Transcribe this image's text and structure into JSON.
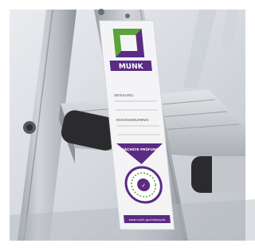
{
  "photo": {
    "subject": "aluminium-ladder-with-inspection-label",
    "colors": {
      "background": "#ffffff",
      "aluminium": "#c3c6ca",
      "aluminium_shadow": "#8e939a",
      "step_cap": "#2b2b2d",
      "label_white": "#f4f4f6",
      "brand_green": "#5aa43a",
      "brand_purple": "#5b2c83"
    }
  },
  "label": {
    "brand": "MUNK",
    "field_1": "ABTEILUNG:",
    "field_2": "INVENTARNUMMER:",
    "inspection_title": "NÄCHSTE PRÜFUNG",
    "website": "www.munk-guenzburg.de"
  }
}
